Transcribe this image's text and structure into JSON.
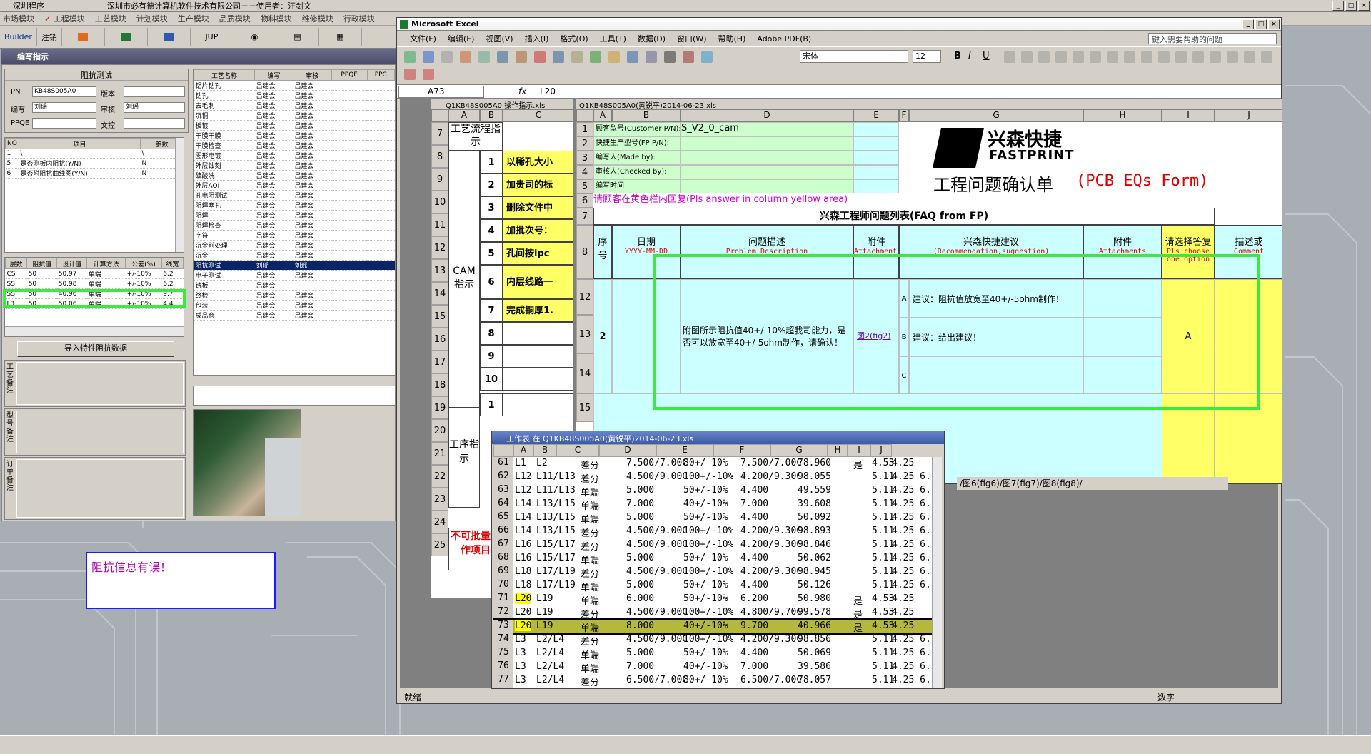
{
  "app": {
    "title": "深圳程序",
    "company": "深圳市必有德计算机软件技术有限公司－－使用者：",
    "user": "汪剑文",
    "menu": [
      "市场模块",
      "工程模块",
      "工艺模块",
      "计划模块",
      "生产模块",
      "品质模块",
      "物料模块",
      "维修模块",
      "行政模块"
    ],
    "toolbar": [
      "Builder",
      "注销",
      "",
      "",
      "",
      "JUP",
      "",
      "",
      ""
    ]
  },
  "panel": {
    "title": "编写指示",
    "group_title": "阻抗测试",
    "fields": {
      "pn_label": "PN",
      "pn_value": "KB48S005A0",
      "version_label": "版本",
      "version_value": "",
      "writer_label": "编写",
      "writer_value": "刘瑶",
      "reviewer_label": "审核",
      "reviewer_value": "刘瑶",
      "ppqe_label": "PPQE",
      "ppqe_value": "",
      "doc_label": "文控",
      "doc_value": ""
    },
    "items_headers": [
      "NO",
      "项目",
      "参数"
    ],
    "items": [
      [
        "1",
        "\\",
        "\\"
      ],
      [
        "5",
        "是否测板内阻抗(Y/N)",
        "N"
      ],
      [
        "6",
        "是否附阻抗曲线图(Y/N)",
        "N"
      ]
    ],
    "imp_headers": [
      "层数",
      "阻抗值",
      "设计值",
      "计算方法",
      "公差(%)",
      "线宽"
    ],
    "imp_rows": [
      [
        "CS",
        "50",
        "50.97",
        "单端",
        "+/-10%",
        "6.2"
      ],
      [
        "SS",
        "50",
        "50.98",
        "单端",
        "+/-10%",
        "6.2"
      ],
      [
        "SS",
        "50",
        "40.96",
        "单端",
        "+/-10%",
        "9.7"
      ],
      [
        "L3",
        "50",
        "50.06",
        "单端",
        "+/-10%",
        "4.4"
      ]
    ],
    "import_button": "导入特性阻抗数据",
    "memo1": "工艺备注",
    "memo2": "型号备注",
    "memo3": "订单备注",
    "proc_headers": [
      "工艺名称",
      "编写",
      "审核",
      "PPQE",
      "PPC"
    ],
    "proc_rows": [
      [
        "铝片钻孔",
        "吕建会",
        "吕建会"
      ],
      [
        "钻孔",
        "吕建会",
        "吕建会"
      ],
      [
        "去毛刺",
        "吕建会",
        "吕建会"
      ],
      [
        "沉铜",
        "吕建会",
        "吕建会"
      ],
      [
        "板镀",
        "吕建会",
        "吕建会"
      ],
      [
        "干膜干膜",
        "吕建会",
        "吕建会"
      ],
      [
        "干膜检查",
        "吕建会",
        "吕建会"
      ],
      [
        "图形电镀",
        "吕建会",
        "吕建会"
      ],
      [
        "外层蚀刻",
        "吕建会",
        "吕建会"
      ],
      [
        "硫酸洗",
        "吕建会",
        "吕建会"
      ],
      [
        "外层AOI",
        "吕建会",
        "吕建会"
      ],
      [
        "孔电阻测试",
        "吕建会",
        "吕建会"
      ],
      [
        "阻焊塞孔",
        "吕建会",
        "吕建会"
      ],
      [
        "阻焊",
        "吕建会",
        "吕建会"
      ],
      [
        "阻焊检查",
        "吕建会",
        "吕建会"
      ],
      [
        "字符",
        "吕建会",
        "吕建会"
      ],
      [
        "沉金前处理",
        "吕建会",
        "吕建会"
      ],
      [
        "沉金",
        "吕建会",
        "吕建会"
      ],
      [
        "阻抗测试",
        "刘瑶",
        "刘瑶"
      ],
      [
        "电子测试",
        "吕建会",
        "吕建会"
      ],
      [
        "铣板",
        "吕建会",
        ""
      ],
      [
        "终检",
        "吕建会",
        "吕建会"
      ],
      [
        "包装",
        "吕建会",
        "吕建会"
      ],
      [
        "成品仓",
        "吕建会",
        "吕建会"
      ]
    ],
    "notice": "阻抗信息有误！"
  },
  "excel": {
    "title": "Microsoft Excel",
    "menu": [
      "文件(F)",
      "编辑(E)",
      "视图(V)",
      "插入(I)",
      "格式(O)",
      "工具(T)",
      "数据(D)",
      "窗口(W)",
      "帮助(H)",
      "Adobe PDF(B)"
    ],
    "ask": "键入需要帮助的问题",
    "font": "宋体",
    "size": "12",
    "namebox": "A73",
    "fx": "fx",
    "formula": "L20",
    "status": "就绪",
    "status_right": "数字",
    "s1": {
      "title": "Q1KB48S005A0 操作指示.xls",
      "cols": [
        "A",
        "B",
        "C"
      ],
      "process_title": "工艺流程指示",
      "cam": "CAM指示",
      "proc": "工序指示",
      "reject": "不可批量制作项目",
      "rows": [
        "7",
        "8",
        "9",
        "10",
        "11",
        "12",
        "13",
        "14",
        "15",
        "16",
        "17",
        "18",
        "19",
        "20",
        "21",
        "22",
        "23",
        "24",
        "25"
      ],
      "items": [
        [
          "1",
          "以稀孔大小"
        ],
        [
          "2",
          "加贵司的标"
        ],
        [
          "3",
          "删除文件中"
        ],
        [
          "4",
          "加批次号："
        ],
        [
          "5",
          "孔间按ipc"
        ],
        [
          "6",
          "内层线路一"
        ],
        [
          "7",
          "完成铜厚1."
        ],
        [
          "8",
          ""
        ],
        [
          "9",
          ""
        ],
        [
          "10",
          ""
        ],
        [
          "1",
          ""
        ]
      ]
    },
    "s2": {
      "title": "Q1KB48S005A0(黄锐平)2014-06-23.xls",
      "cols": [
        "A",
        "B",
        "D",
        "E",
        "F",
        "G",
        "H",
        "I",
        "J"
      ],
      "r1": "顾客型号(Customer P/N):",
      "r1v": "S_V2_0_cam",
      "r2": "快捷生产型号(FP P/N):",
      "r3": "编写人(Made by):",
      "r4": "审核人(Checked by):",
      "r5": "编写时间",
      "r6": "请顾客在黄色栏内回复(Pls answer in column yellow area)",
      "company_cn": "兴森快捷",
      "company_en": "FASTPRINT",
      "form_title_cn": "工程问题确认单",
      "form_title_en": "(PCB EQs Form)",
      "faq": "兴森工程师问题列表(FAQ from FP)",
      "h_no": "序号",
      "h_date": "日期",
      "h_date2": "YYYY-MM-DD",
      "h_problem": "问题描述",
      "h_problem_en": "Problem Description",
      "h_att": "附件",
      "h_att_en": "Attachments",
      "h_rec": "兴森快捷建议",
      "h_rec_en": "(Recommendation,suggestion)",
      "h_att2": "附件",
      "h_att2_en": "Attachments",
      "h_choose": "请选择答复",
      "h_choose_en": "Pls choose one option",
      "h_desc": "描述或",
      "h_desc_en": "Comment",
      "no": "2",
      "problem": "附图所示阻抗值40+/-10%超我司能力，是否可以放宽至40+/-5ohm制作，请确认！",
      "att": "图2(fig2)",
      "optA": "A",
      "optB": "B",
      "optC": "C",
      "recA": "建议：阻抗值放宽至40+/-5ohm制作！",
      "recB": "建议：给出建议！",
      "answer": "A",
      "row_nums": [
        "1",
        "2",
        "3",
        "4",
        "5",
        "6",
        "7",
        "8",
        "12",
        "13",
        "14",
        "15"
      ],
      "tabs": "/图6(fig6)/图7(fig7)/图8(fig8)/"
    },
    "s3": {
      "title": "工作表 在 Q1KB48S005A0(黄锐平)2014-06-23.xls",
      "cols": [
        "A",
        "B",
        "C",
        "D",
        "E",
        "F",
        "G",
        "H",
        "I",
        "J"
      ],
      "rows": [
        [
          "61",
          "L1",
          "L2",
          "差分",
          "7.500/7.00C",
          "80+/-10%",
          "7.500/7.00C",
          "78.960",
          "是",
          "4.53",
          "4.25"
        ],
        [
          "62",
          "L12",
          "L11/L13",
          "差分",
          "4.500/9.00C",
          "100+/-10%",
          "4.200/9.30C",
          "98.055",
          "",
          "5.11",
          "4.25 6."
        ],
        [
          "63",
          "L12",
          "L11/L13",
          "单端",
          "5.000",
          "50+/-10%",
          "4.400",
          "49.559",
          "",
          "5.11",
          "4.25 6."
        ],
        [
          "64",
          "L14",
          "L13/L15",
          "单端",
          "7.000",
          "40+/-10%",
          "7.000",
          "39.608",
          "",
          "5.11",
          "4.25 6."
        ],
        [
          "65",
          "L14",
          "L13/L15",
          "单端",
          "5.000",
          "50+/-10%",
          "4.400",
          "50.092",
          "",
          "5.11",
          "4.25 6."
        ],
        [
          "66",
          "L14",
          "L13/L15",
          "差分",
          "4.500/9.00C",
          "100+/-10%",
          "4.200/9.30C",
          "98.893",
          "",
          "5.11",
          "4.25 6."
        ],
        [
          "67",
          "L16",
          "L15/L17",
          "差分",
          "4.500/9.00C",
          "100+/-10%",
          "4.200/9.30C",
          "98.846",
          "",
          "5.11",
          "4.25 6."
        ],
        [
          "68",
          "L16",
          "L15/L17",
          "单端",
          "5.000",
          "50+/-10%",
          "4.400",
          "50.062",
          "",
          "5.11",
          "4.25 6."
        ],
        [
          "69",
          "L18",
          "L17/L19",
          "差分",
          "4.500/9.00C",
          "100+/-10%",
          "4.200/9.30C",
          "98.945",
          "",
          "5.11",
          "4.25 6."
        ],
        [
          "70",
          "L18",
          "L17/L19",
          "单端",
          "5.000",
          "50+/-10%",
          "4.400",
          "50.126",
          "",
          "5.11",
          "4.25 6."
        ],
        [
          "71",
          "L20",
          "L19",
          "单端",
          "6.000",
          "50+/-10%",
          "6.200",
          "50.980",
          "是",
          "4.53",
          "4.25"
        ],
        [
          "72",
          "L20",
          "L19",
          "差分",
          "4.500/9.00C",
          "100+/-10%",
          "4.800/9.70C",
          "99.578",
          "是",
          "4.53",
          "4.25"
        ],
        [
          "73",
          "L20",
          "L19",
          "单端",
          "8.000",
          "40+/-10%",
          "9.700",
          "40.966",
          "是",
          "4.53",
          "4.25"
        ],
        [
          "74",
          "L3",
          "L2/L4",
          "差分",
          "4.500/9.00C",
          "100+/-10%",
          "4.200/9.30C",
          "98.856",
          "",
          "5.11",
          "4.25 6."
        ],
        [
          "75",
          "L3",
          "L2/L4",
          "单端",
          "5.000",
          "50+/-10%",
          "4.400",
          "50.069",
          "",
          "5.11",
          "4.25 6."
        ],
        [
          "76",
          "L3",
          "L2/L4",
          "单端",
          "7.000",
          "40+/-10%",
          "7.000",
          "39.586",
          "",
          "5.11",
          "4.25 6."
        ],
        [
          "77",
          "L3",
          "L2/L4",
          "差分",
          "6.500/7.00C",
          "80+/-10%",
          "6.500/7.00C",
          "78.057",
          "",
          "5.11",
          "4.25 6."
        ]
      ]
    }
  },
  "colors": {
    "highlight": "#3fe83f",
    "selection": "#0a246a",
    "row_highlight": "#b5b83a",
    "yellow": "#ffff66",
    "cyan": "#ccffff",
    "green_cell": "#ccffcc"
  }
}
